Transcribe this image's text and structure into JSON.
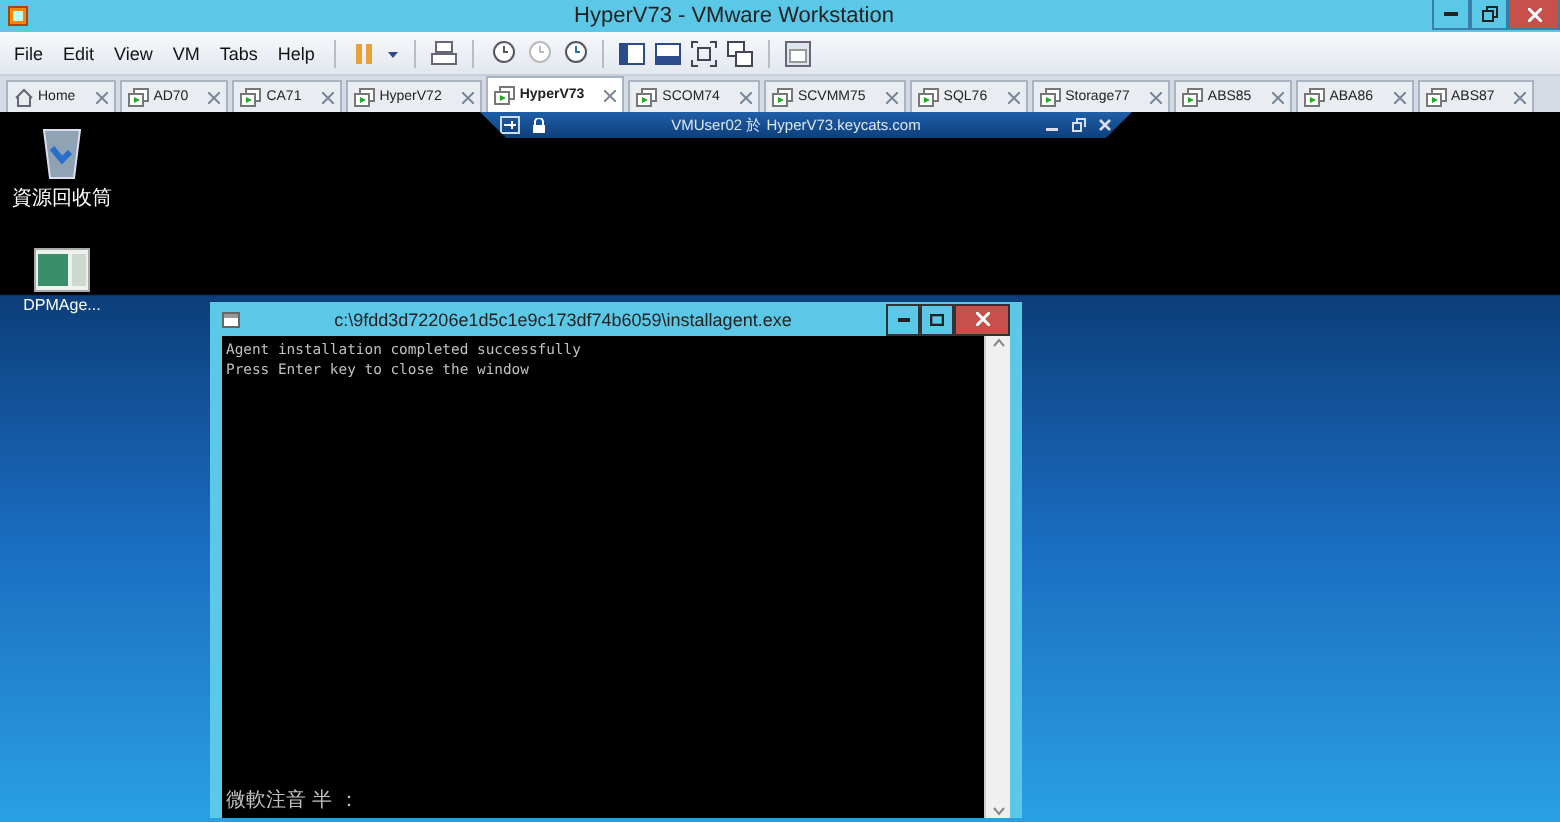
{
  "window": {
    "title": "HyperV73 - VMware Workstation"
  },
  "menu": [
    "File",
    "Edit",
    "View",
    "VM",
    "Tabs",
    "Help"
  ],
  "tabs": [
    {
      "label": "Home",
      "kind": "home",
      "selected": false
    },
    {
      "label": "AD70",
      "kind": "vm",
      "selected": false
    },
    {
      "label": "CA71",
      "kind": "vm",
      "selected": false
    },
    {
      "label": "HyperV72",
      "kind": "vm",
      "selected": false
    },
    {
      "label": "HyperV73",
      "kind": "vm",
      "selected": true
    },
    {
      "label": "SCOM74",
      "kind": "vm",
      "selected": false
    },
    {
      "label": "SCVMM75",
      "kind": "vm",
      "selected": false
    },
    {
      "label": "SQL76",
      "kind": "vm",
      "selected": false
    },
    {
      "label": "Storage77",
      "kind": "vm",
      "selected": false
    },
    {
      "label": "ABS85",
      "kind": "vm",
      "selected": false
    },
    {
      "label": "ABA86",
      "kind": "vm",
      "selected": false
    },
    {
      "label": "ABS87",
      "kind": "vm",
      "selected": false
    }
  ],
  "fullscreen_bar": {
    "title": "VMUser02 於 HyperV73.keycats.com"
  },
  "desktop_icons": [
    {
      "label": "資源回收筒",
      "kind": "recycle"
    },
    {
      "label": "DPMAge...",
      "kind": "app"
    }
  ],
  "console": {
    "title": "c:\\9fdd3d72206e1d5c1e9c173df74b6059\\installagent.exe",
    "lines": [
      "Agent installation completed successfully",
      "Press Enter key to close the window"
    ],
    "ime_status": "微軟注音 半 ："
  }
}
